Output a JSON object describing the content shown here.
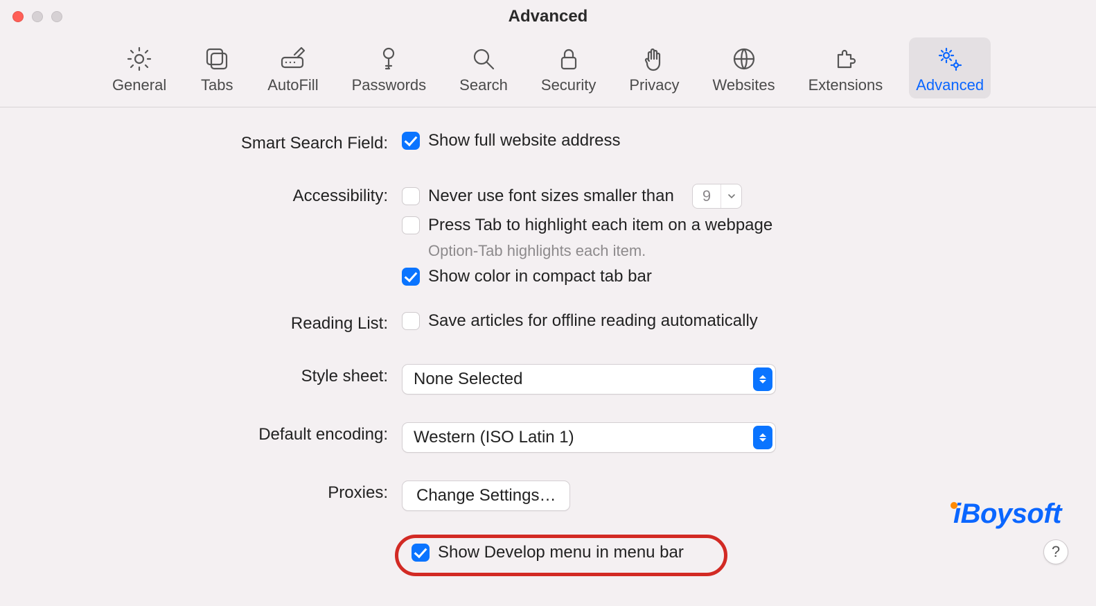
{
  "window": {
    "title": "Advanced"
  },
  "tabs": [
    {
      "id": "general",
      "label": "General"
    },
    {
      "id": "tabs",
      "label": "Tabs"
    },
    {
      "id": "autofill",
      "label": "AutoFill"
    },
    {
      "id": "passwords",
      "label": "Passwords"
    },
    {
      "id": "search",
      "label": "Search"
    },
    {
      "id": "security",
      "label": "Security"
    },
    {
      "id": "privacy",
      "label": "Privacy"
    },
    {
      "id": "websites",
      "label": "Websites"
    },
    {
      "id": "extensions",
      "label": "Extensions"
    },
    {
      "id": "advanced",
      "label": "Advanced"
    }
  ],
  "sections": {
    "smartSearch": {
      "label": "Smart Search Field:",
      "showFull": {
        "text": "Show full website address",
        "checked": true
      }
    },
    "accessibility": {
      "label": "Accessibility:",
      "minFont": {
        "text": "Never use font sizes smaller than",
        "checked": false,
        "value": "9"
      },
      "pressTab": {
        "text": "Press Tab to highlight each item on a webpage",
        "checked": false
      },
      "hint": "Option-Tab highlights each item.",
      "compactColor": {
        "text": "Show color in compact tab bar",
        "checked": true
      }
    },
    "readingList": {
      "label": "Reading List:",
      "offline": {
        "text": "Save articles for offline reading automatically",
        "checked": false
      }
    },
    "styleSheet": {
      "label": "Style sheet:",
      "value": "None Selected"
    },
    "encoding": {
      "label": "Default encoding:",
      "value": "Western (ISO Latin 1)"
    },
    "proxies": {
      "label": "Proxies:",
      "button": "Change Settings…"
    },
    "develop": {
      "text": "Show Develop menu in menu bar",
      "checked": true
    }
  },
  "help": {
    "glyph": "?"
  },
  "watermark": {
    "text": "iBoysoft"
  }
}
